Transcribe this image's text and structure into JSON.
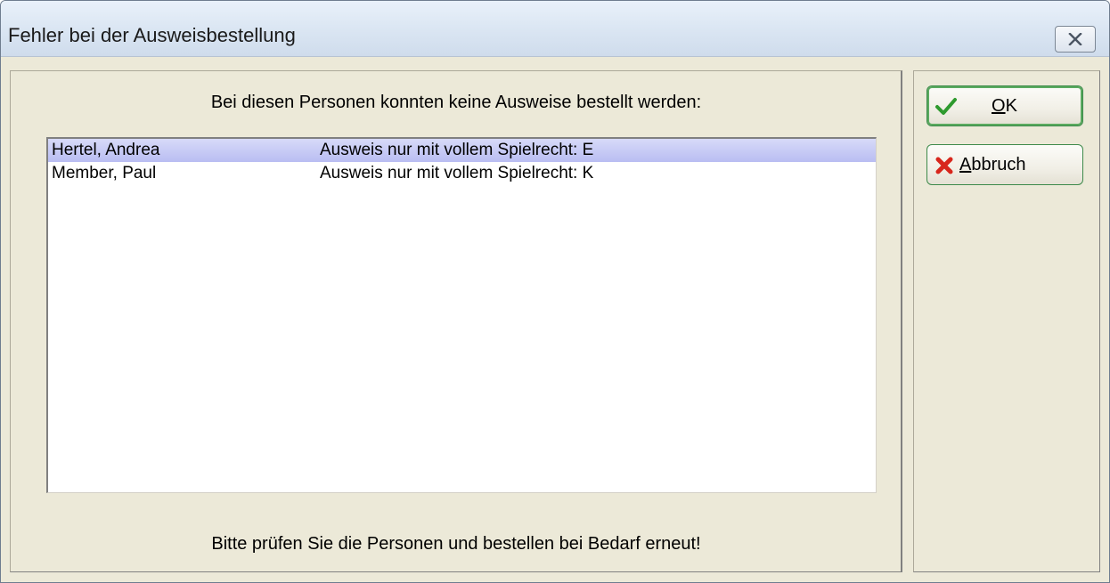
{
  "window": {
    "title": "Fehler bei der Ausweisbestellung"
  },
  "message": {
    "header": "Bei diesen Personen konnten keine Ausweise bestellt werden:",
    "footer": "Bitte prüfen Sie die Personen und bestellen bei Bedarf erneut!"
  },
  "list": {
    "rows": [
      {
        "name": "Hertel, Andrea",
        "reason": "Ausweis nur mit vollem Spielrecht: E",
        "selected": true
      },
      {
        "name": "Member, Paul",
        "reason": "Ausweis nur mit vollem Spielrecht: K",
        "selected": false
      }
    ]
  },
  "buttons": {
    "ok": {
      "mnemonic": "O",
      "rest": "K",
      "icon": "checkmark-icon"
    },
    "cancel": {
      "mnemonic": "A",
      "rest": "bbruch",
      "icon": "red-x-icon"
    }
  },
  "colors": {
    "dialog_bg": "#ece9d8",
    "selection": "#b9bdf2",
    "button_border": "#3d8a4a",
    "ok_icon": "#2e9a2e",
    "cancel_icon": "#d8261c"
  }
}
